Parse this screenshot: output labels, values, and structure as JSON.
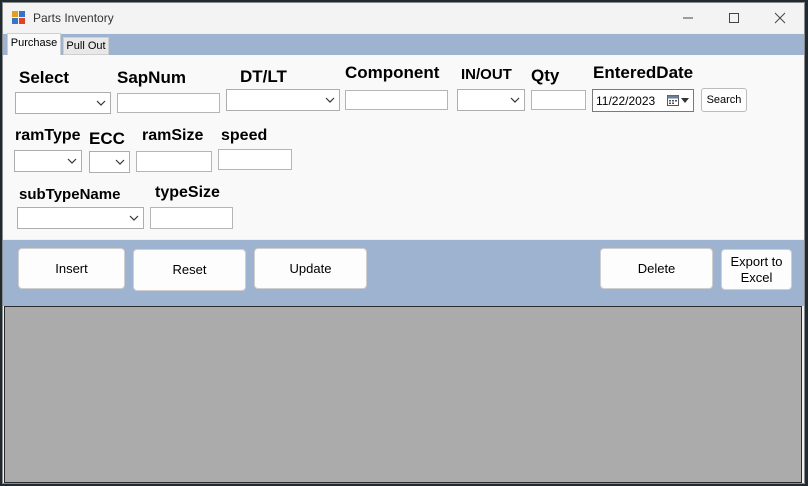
{
  "window": {
    "title": "Parts Inventory"
  },
  "tabs": [
    "Purchase",
    "Pull Out"
  ],
  "labels": {
    "select": "Select",
    "sapnum": "SapNum",
    "dtlt": "DT/LT",
    "component": "Component",
    "inout": "IN/OUT",
    "qty": "Qty",
    "entereddate": "EnteredDate",
    "ramtype": "ramType",
    "ecc": "ECC",
    "ramsize": "ramSize",
    "speed": "speed",
    "subtypename": "subTypeName",
    "typesize": "typeSize"
  },
  "date_value": "11/22/2023",
  "buttons": {
    "search": "Search",
    "insert": "Insert",
    "reset": "Reset",
    "update": "Update",
    "delete": "Delete",
    "export": "Export to Excel"
  },
  "colors": {
    "band": "#9db3d0",
    "grid": "#ababab"
  }
}
